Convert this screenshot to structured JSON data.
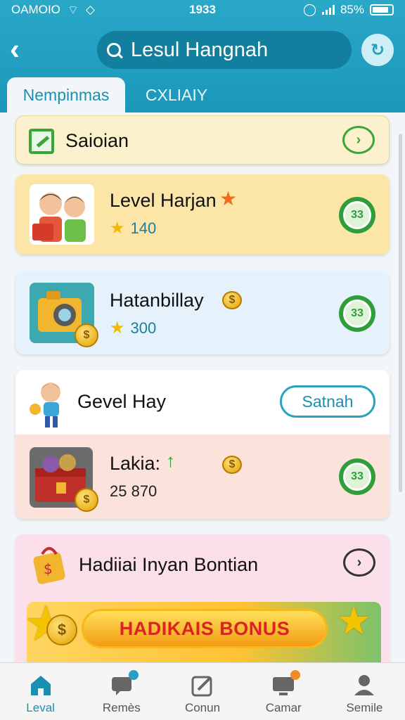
{
  "status": {
    "carrier": "OAMOIO",
    "time": "1933",
    "battery": "85%"
  },
  "topbar": {
    "title": "Lesul Hangnah"
  },
  "tabs": [
    {
      "label": "Nempinmas",
      "active": true
    },
    {
      "label": "CXLIAIY",
      "active": false
    }
  ],
  "cards": {
    "savings": {
      "title": "Saioian"
    },
    "level": {
      "title": "Level Harjan",
      "stars": "140",
      "badge": "33"
    },
    "hatan": {
      "title": "Hatanbillay",
      "stars": "300",
      "badge": "33"
    },
    "gevel": {
      "title": "Gevel Hay",
      "button": "Satnah"
    },
    "lakia": {
      "title": "Lakia:",
      "value": "25 870",
      "badge": "33"
    },
    "hadiah": {
      "title": "Hadiiai Inyan Bontian",
      "banner": "HADIKAIS BONUS"
    }
  },
  "nav": [
    {
      "label": "Leval",
      "active": true,
      "icon": "home-icon"
    },
    {
      "label": "Remès",
      "icon": "chat-icon",
      "dot": "#2a9ec0"
    },
    {
      "label": "Conun",
      "icon": "edit-icon"
    },
    {
      "label": "Camar",
      "icon": "monitor-icon",
      "dot": "#f08a24"
    },
    {
      "label": "Semile",
      "icon": "profile-icon"
    }
  ],
  "colors": {
    "header": "#1c97ba",
    "accent": "#1b8fb0",
    "badge": "#2f9e3a",
    "banner_text": "#d7261e"
  }
}
